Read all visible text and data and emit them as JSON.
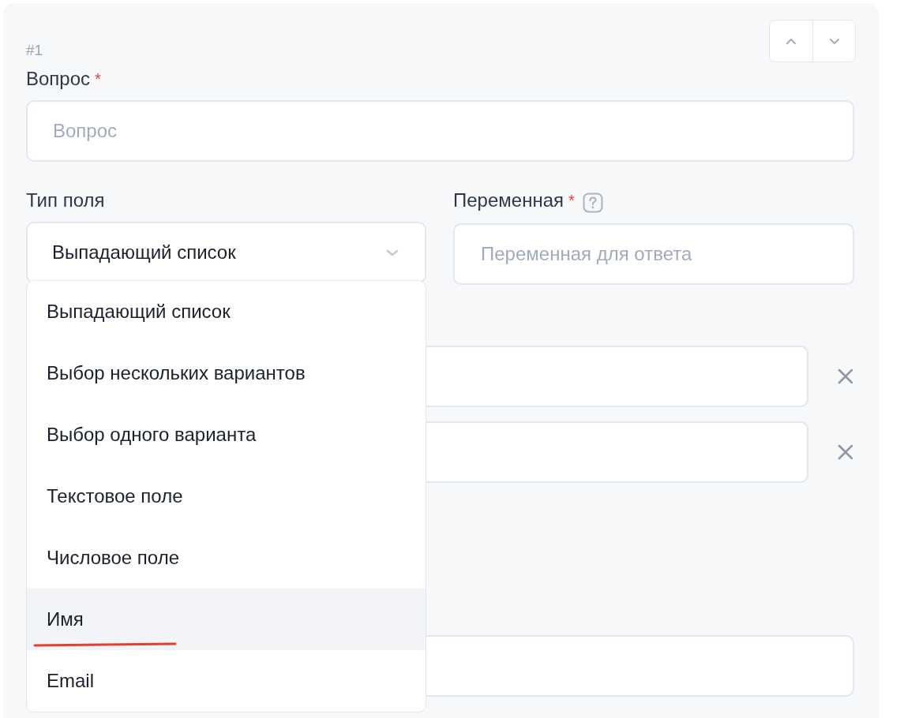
{
  "question": {
    "number": "#1",
    "label": "Вопрос",
    "required_mark": "*",
    "placeholder": "Вопрос"
  },
  "field_type": {
    "label": "Тип поля",
    "value": "Выпадающий список",
    "expanded": true,
    "options": [
      {
        "label": "Выпадающий список",
        "highlighted": false
      },
      {
        "label": "Выбор нескольких вариантов",
        "highlighted": false
      },
      {
        "label": "Выбор одного варианта",
        "highlighted": false
      },
      {
        "label": "Текстовое поле",
        "highlighted": false
      },
      {
        "label": "Числовое поле",
        "highlighted": false
      },
      {
        "label": "Имя",
        "highlighted": true
      },
      {
        "label": "Email",
        "highlighted": false
      }
    ]
  },
  "variable": {
    "label": "Переменная",
    "required_mark": "*",
    "placeholder": "Переменная для ответа"
  },
  "answer_rows": [
    {
      "removable": true
    },
    {
      "removable": true
    }
  ]
}
